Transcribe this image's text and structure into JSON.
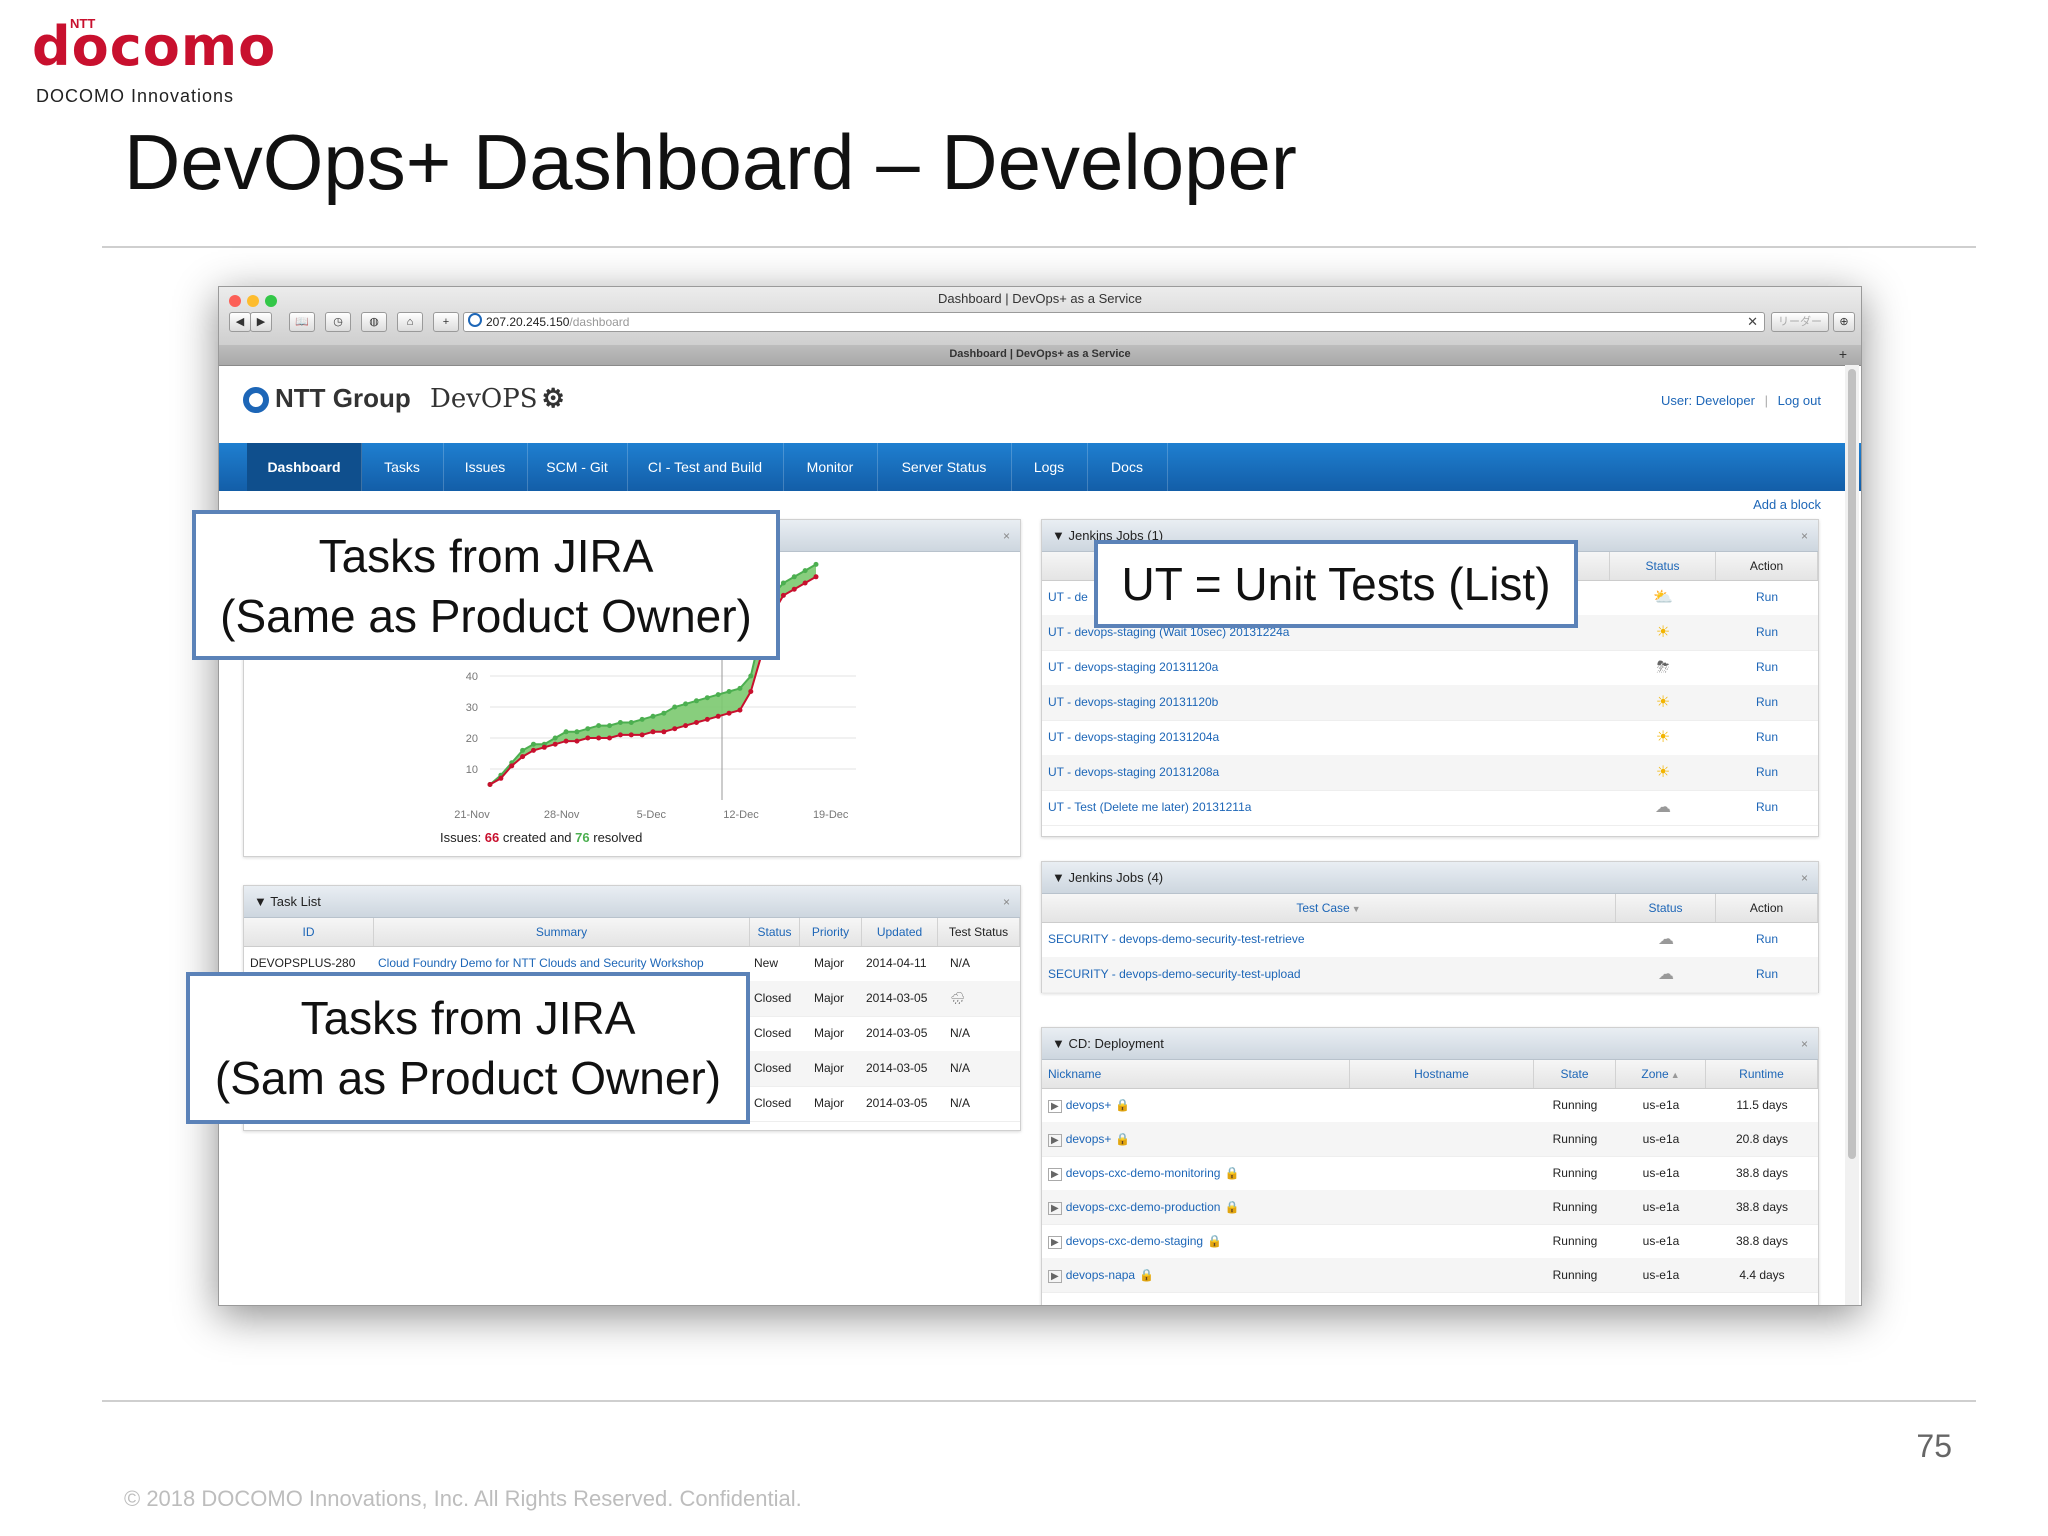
{
  "slide": {
    "logo_small": "NTT",
    "logo_brand": "docomo",
    "logo_subtitle": "DOCOMO Innovations",
    "title": "DevOps+ Dashboard – Developer",
    "page_number": "75",
    "copyright": "© 2018 DOCOMO Innovations, Inc. All Rights Reserved. Confidential.",
    "colors": {
      "brand_red": "#c8102e",
      "nav_blue": "#1f7fd0",
      "callout_border": "#5b82b8"
    }
  },
  "browser": {
    "window_title": "Dashboard | DevOps+ as a Service",
    "tab_title": "Dashboard | DevOps+ as a Service",
    "url_host": "207.20.245.150",
    "url_path": "/dashboard",
    "reader_label": "リーダー",
    "buttons": {
      "back": "◀",
      "forward": "▶",
      "bookmarks": "📖",
      "history": "◷",
      "shield": "◍",
      "home": "⌂",
      "add": "+",
      "clear": "✕",
      "download": "⊕",
      "new_tab": "+"
    }
  },
  "app": {
    "brand_ntt": "NTT Group",
    "brand_devops": "DevOPS",
    "user_label": "User: Developer",
    "logout_label": "Log out",
    "add_block": "Add a block",
    "nav": [
      {
        "label": "Dashboard"
      },
      {
        "label": "Tasks"
      },
      {
        "label": "Issues"
      },
      {
        "label": "SCM - Git"
      },
      {
        "label": "CI - Test and Build"
      },
      {
        "label": "Monitor"
      },
      {
        "label": "Server Status"
      },
      {
        "label": "Logs"
      },
      {
        "label": "Docs"
      }
    ]
  },
  "chart_panel": {
    "close": "×",
    "summary_prefix": "Issues: ",
    "created": "66",
    "summary_mid": " created and ",
    "resolved": "76",
    "summary_suffix": " resolved"
  },
  "chart_data": {
    "type": "area",
    "xtick_labels": [
      "21-Nov",
      "28-Nov",
      "5-Dec",
      "12-Dec",
      "19-Dec"
    ],
    "ytick_labels": [
      "10",
      "20",
      "30",
      "40"
    ],
    "ylim": [
      0,
      80
    ],
    "series": [
      {
        "values": [
          5,
          8,
          12,
          16,
          18,
          18,
          20,
          22,
          22,
          23,
          24,
          24,
          25,
          25,
          26,
          27,
          28,
          30,
          31,
          32,
          33,
          34,
          35,
          36,
          40,
          55,
          66,
          70,
          72,
          74,
          76
        ]
      },
      {
        "values": [
          5,
          7,
          11,
          14,
          16,
          17,
          18,
          19,
          19,
          20,
          20,
          20,
          21,
          21,
          21,
          22,
          22,
          23,
          24,
          25,
          26,
          27,
          28,
          29,
          35,
          47,
          60,
          66,
          68,
          70,
          72
        ]
      }
    ],
    "colors": {
      "created": "#c8102e",
      "resolved": "#4caf50",
      "fill": "#7bc96f"
    }
  },
  "task_list": {
    "title": "▼ Task List",
    "close": "×",
    "columns": [
      "ID",
      "Summary",
      "Status",
      "Priority",
      "Updated",
      "Test Status"
    ],
    "rows": [
      {
        "id": "DEVOPSPLUS-280",
        "summary": "Cloud Foundry Demo for NTT Clouds and Security Workshop",
        "status": "New",
        "priority": "Major",
        "updated": "2014-04-11",
        "test": "N/A"
      },
      {
        "id": "",
        "summary": "",
        "status": "Closed",
        "priority": "Major",
        "updated": "2014-03-05",
        "test": "🌧"
      },
      {
        "id": "",
        "summary": "",
        "status": "Closed",
        "priority": "Major",
        "updated": "2014-03-05",
        "test": "N/A"
      },
      {
        "id": "",
        "summary": "",
        "status": "Closed",
        "priority": "Major",
        "updated": "2014-03-05",
        "test": "N/A"
      },
      {
        "id": "",
        "summary": "",
        "status": "Closed",
        "priority": "Major",
        "updated": "2014-03-05",
        "test": "N/A"
      }
    ]
  },
  "jenkins1": {
    "title": "▼ Jenkins Jobs (1)",
    "close": "×",
    "columns": [
      "Status",
      "Action"
    ],
    "rows": [
      {
        "name": "UT - de",
        "status": "⛅",
        "action": "Run"
      },
      {
        "name": "UT - devops-staging (Wait 10sec) 20131224a",
        "status": "☀",
        "action": "Run"
      },
      {
        "name": "UT - devops-staging 20131120a",
        "status": "⛈",
        "action": "Run"
      },
      {
        "name": "UT - devops-staging 20131120b",
        "status": "☀",
        "action": "Run"
      },
      {
        "name": "UT - devops-staging 20131204a",
        "status": "☀",
        "action": "Run"
      },
      {
        "name": "UT - devops-staging 20131208a",
        "status": "☀",
        "action": "Run"
      },
      {
        "name": "UT - Test (Delete me later) 20131211a",
        "status": "☁",
        "action": "Run"
      }
    ]
  },
  "jenkins4": {
    "title": "▼ Jenkins Jobs (4)",
    "close": "×",
    "columns": [
      "Test Case",
      "Status",
      "Action"
    ],
    "rows": [
      {
        "name": "SECURITY - devops-demo-security-test-retrieve",
        "status": "☁",
        "action": "Run"
      },
      {
        "name": "SECURITY - devops-demo-security-test-upload",
        "status": "☁",
        "action": "Run"
      }
    ]
  },
  "deployment": {
    "title": "▼ CD: Deployment",
    "close": "×",
    "columns": [
      "Nickname",
      "Hostname",
      "State",
      "Zone",
      "Runtime"
    ],
    "rows": [
      {
        "nickname": "devops+",
        "hostname": "",
        "state": "Running",
        "zone": "us-e1a",
        "runtime": "11.5 days"
      },
      {
        "nickname": "devops+",
        "hostname": "",
        "state": "Running",
        "zone": "us-e1a",
        "runtime": "20.8 days"
      },
      {
        "nickname": "devops-cxc-demo-monitoring",
        "hostname": "",
        "state": "Running",
        "zone": "us-e1a",
        "runtime": "38.8 days"
      },
      {
        "nickname": "devops-cxc-demo-production",
        "hostname": "",
        "state": "Running",
        "zone": "us-e1a",
        "runtime": "38.8 days"
      },
      {
        "nickname": "devops-cxc-demo-staging",
        "hostname": "",
        "state": "Running",
        "zone": "us-e1a",
        "runtime": "38.8 days"
      },
      {
        "nickname": "devops-napa",
        "hostname": "",
        "state": "Running",
        "zone": "us-e1a",
        "runtime": "4.4 days"
      }
    ]
  },
  "callouts": {
    "top_left": [
      "Tasks from JIRA",
      "(Same as Product Owner)"
    ],
    "unit_tests": [
      "UT = Unit Tests (List)"
    ],
    "bottom_left": [
      "Tasks from JIRA",
      "(Sam as Product Owner)"
    ]
  }
}
